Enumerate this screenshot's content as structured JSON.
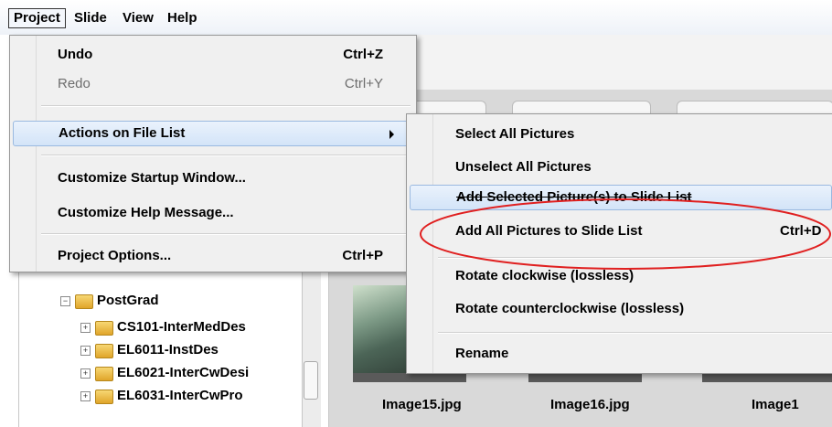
{
  "menubar": {
    "items": [
      {
        "label": "Project",
        "active": true
      },
      {
        "label": "Slide"
      },
      {
        "label": "View"
      },
      {
        "label": "Help"
      }
    ]
  },
  "project_menu": {
    "undo": {
      "label": "Undo",
      "shortcut": "Ctrl+Z"
    },
    "redo": {
      "label": "Redo",
      "shortcut": "Ctrl+Y",
      "disabled": true
    },
    "actions": {
      "label": "Actions on File List",
      "highlighted": true
    },
    "customize_startup": {
      "label": "Customize Startup Window..."
    },
    "customize_help": {
      "label": "Customize Help Message..."
    },
    "project_options": {
      "label": "Project Options...",
      "shortcut": "Ctrl+P"
    }
  },
  "submenu": {
    "select_all": {
      "label": "Select All Pictures"
    },
    "unselect_all": {
      "label": "Unselect All Pictures"
    },
    "add_selected": {
      "label": "Add Selected Picture(s) to Slide List",
      "highlighted": true
    },
    "add_all": {
      "label": "Add All Pictures to Slide List",
      "shortcut": "Ctrl+D"
    },
    "rotate_cw": {
      "label": "Rotate clockwise (lossless)"
    },
    "rotate_ccw": {
      "label": "Rotate counterclockwise (lossless)"
    },
    "rename": {
      "label": "Rename"
    }
  },
  "tree": {
    "items": [
      {
        "label": "PostGrad",
        "toggle": "−"
      },
      {
        "label": "CS101-InterMedDes",
        "toggle": "+"
      },
      {
        "label": "EL6011-InstDes",
        "toggle": "+"
      },
      {
        "label": "EL6021-InterCwDesi",
        "toggle": "+"
      },
      {
        "label": "EL6031-InterCwPro",
        "toggle": "+"
      }
    ]
  },
  "thumbnails": [
    {
      "caption": "Image15.jpg"
    },
    {
      "caption": "Image16.jpg"
    },
    {
      "caption": "Image1"
    }
  ],
  "colors": {
    "highlight": "#d3e4f8",
    "annotation": "#e02020",
    "menu_bg": "#f0f0f0"
  }
}
